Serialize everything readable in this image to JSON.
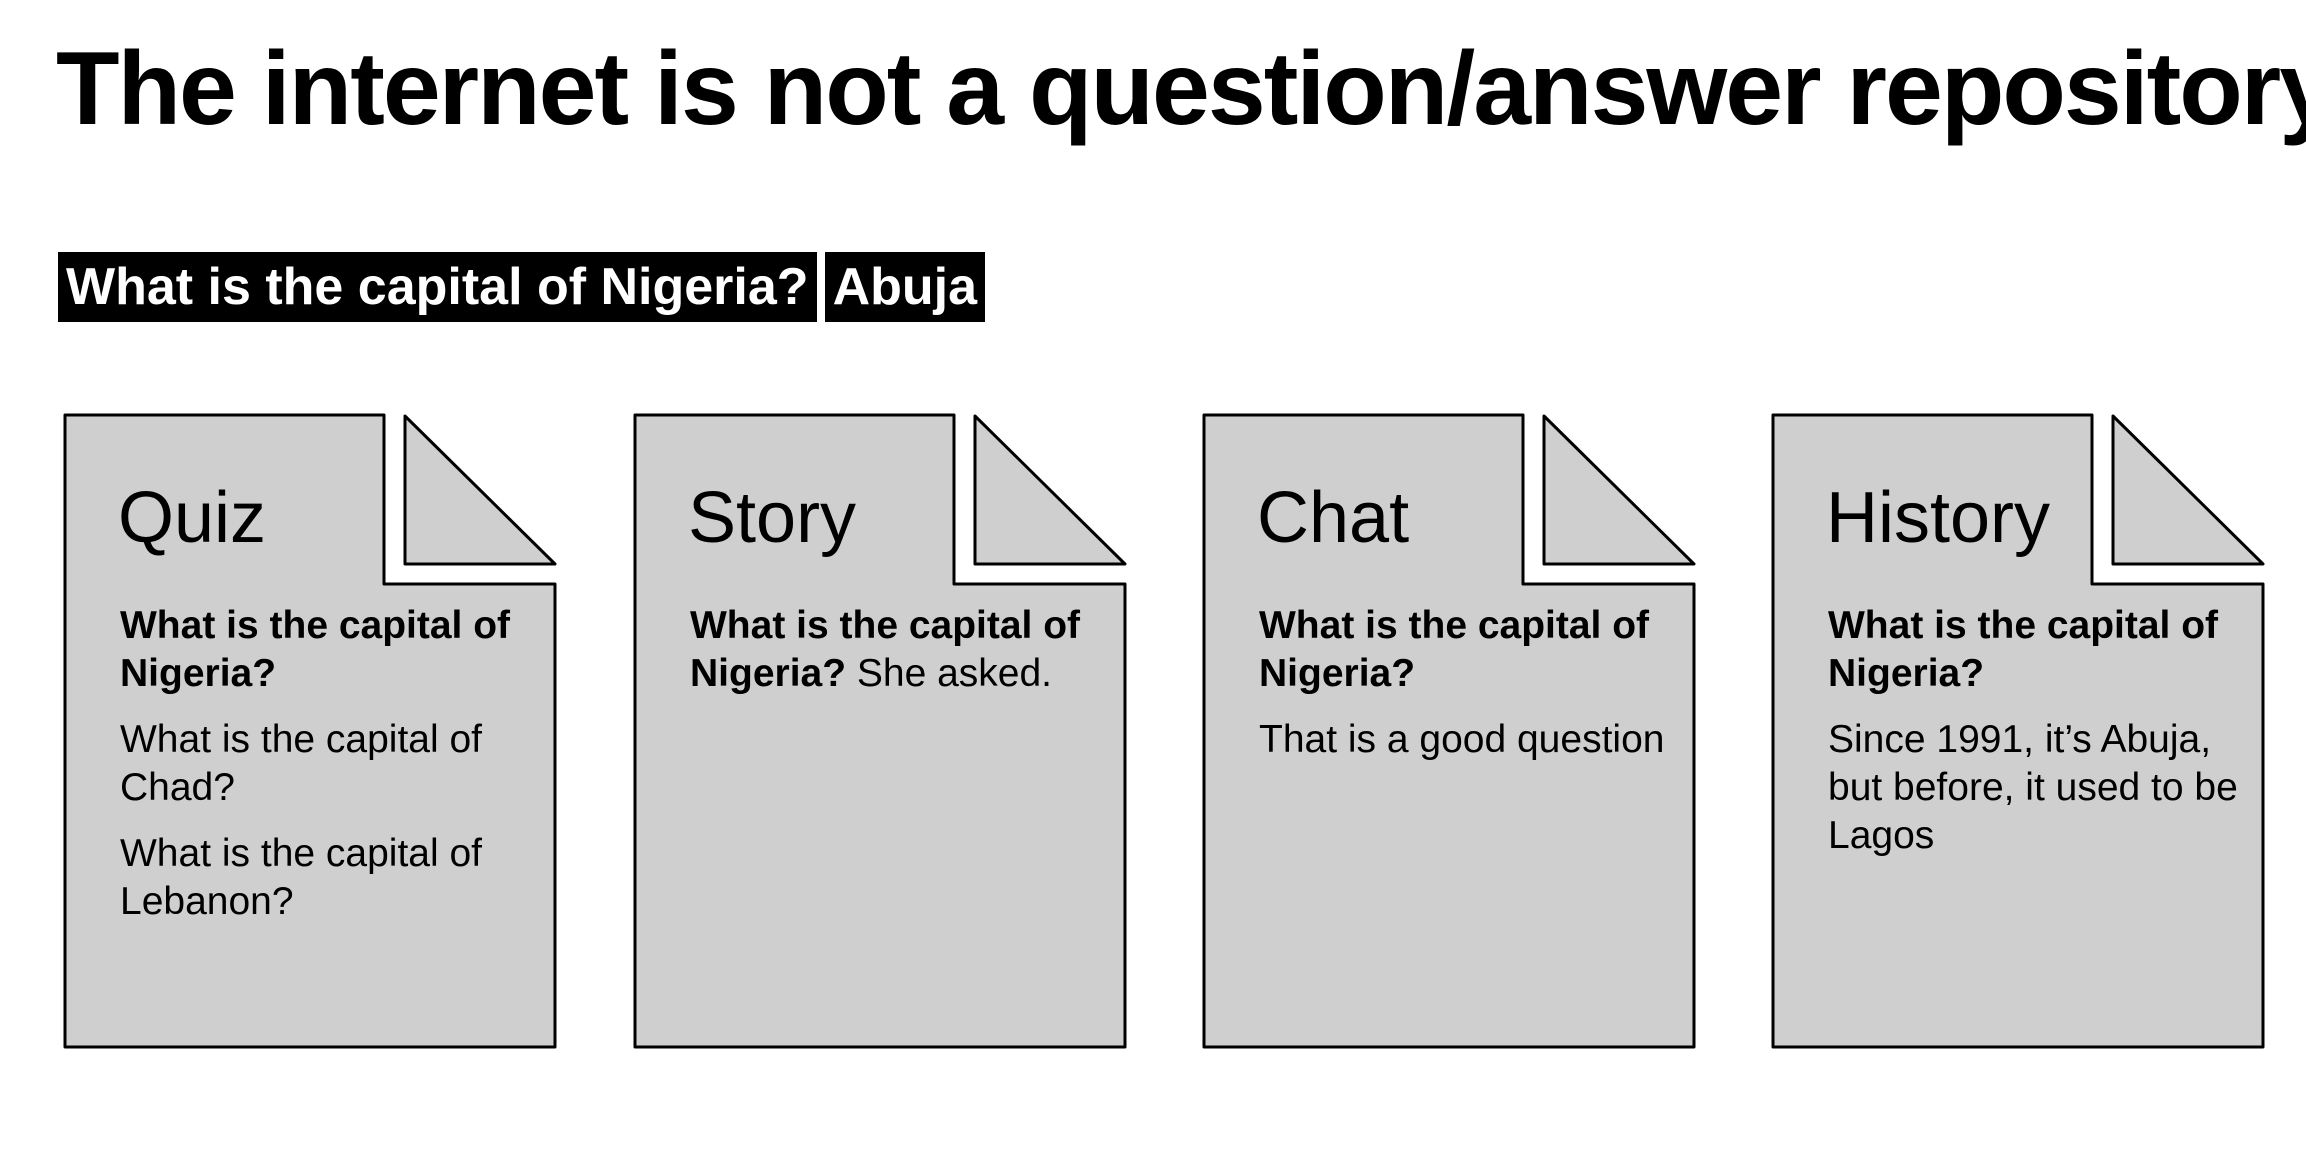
{
  "title": "The internet is not a question/answer repository",
  "qa": {
    "question": "What is the capital of Nigeria?",
    "answer": "Abuja"
  },
  "colors": {
    "doc_fill": "#cfcfcf",
    "doc_stroke": "#000000",
    "chip_bg": "#000000",
    "chip_text": "#ffffff"
  },
  "documents": [
    {
      "title": "Quiz",
      "question": "What is the capital of Nigeria?",
      "lines": [
        "What is the capital of Chad?",
        "What is the capital of Lebanon?"
      ]
    },
    {
      "title": "Story",
      "question": "What is the capital of Nigeria?",
      "suffix": " She asked."
    },
    {
      "title": "Chat",
      "question": "What is the capital of Nigeria?",
      "lines": [
        "That is a good question"
      ]
    },
    {
      "title": "History",
      "question": "What is the capital of Nigeria?",
      "lines": [
        "Since 1991, it’s Abuja, but before, it used to be Lagos"
      ]
    }
  ]
}
